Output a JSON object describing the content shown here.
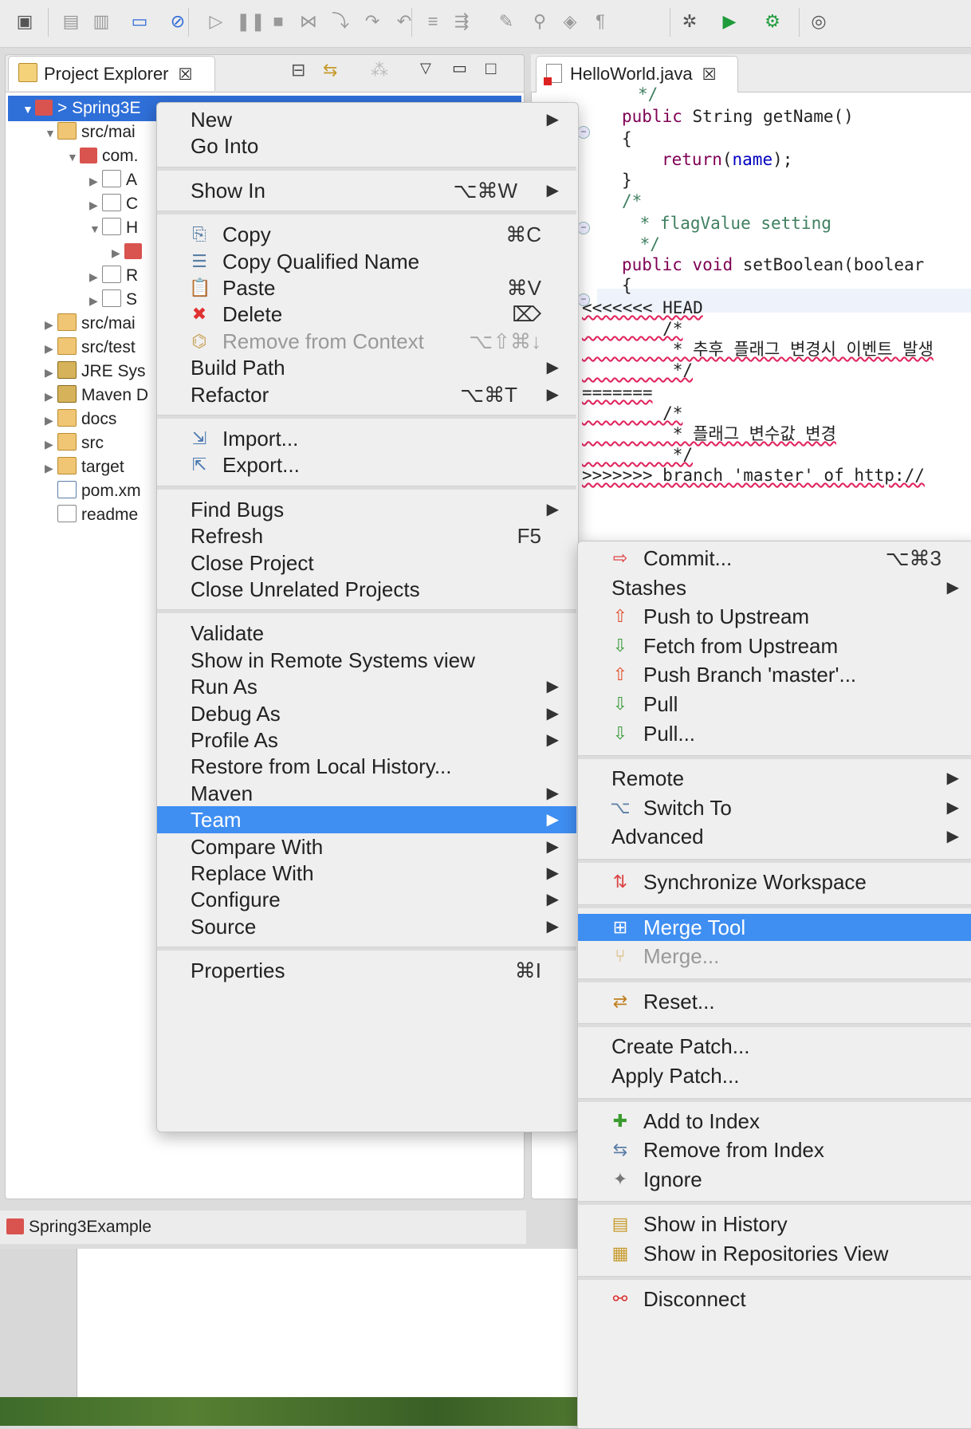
{
  "toolbar": {
    "icons": [
      "new-wizard-icon",
      "save-icon",
      "save-all-icon",
      "console-icon",
      "skip-breakpoints-icon",
      "resume-icon",
      "suspend-icon",
      "terminate-icon",
      "disconnect-icon",
      "step-into-icon",
      "step-over-icon",
      "step-return-icon",
      "toggle-mark-icon",
      "open-type-icon",
      "ant-icon",
      "search-icon",
      "build-icon",
      "format-icon",
      "bug-icon",
      "run-icon",
      "external-tools-icon",
      "web-browser-icon"
    ]
  },
  "explorer": {
    "tab_label": "Project Explorer",
    "close_glyph": "☒",
    "tree": [
      {
        "label": "> Spring3E",
        "twisty": "▼",
        "icon": "maven-project-icon",
        "selected": true
      },
      {
        "label": "src/mai",
        "twisty": "▼",
        "icon": "source-folder-icon"
      },
      {
        "label": "com.",
        "twisty": "▼",
        "icon": "package-icon"
      },
      {
        "label": "A",
        "twisty": "▶",
        "icon": "java-file-icon"
      },
      {
        "label": "C",
        "twisty": "▶",
        "icon": "java-file-icon"
      },
      {
        "label": "H",
        "twisty": "▼",
        "icon": "java-file-icon"
      },
      {
        "label": "",
        "twisty": "▶",
        "icon": "class-icon"
      },
      {
        "label": "R",
        "twisty": "▶",
        "icon": "java-file-icon"
      },
      {
        "label": "S",
        "twisty": "▶",
        "icon": "java-file-icon"
      },
      {
        "label": "src/mai",
        "twisty": "▶",
        "icon": "source-folder-icon"
      },
      {
        "label": "src/test",
        "twisty": "▶",
        "icon": "source-folder-icon"
      },
      {
        "label": "JRE Sys",
        "twisty": "▶",
        "icon": "library-icon"
      },
      {
        "label": "Maven D",
        "twisty": "▶",
        "icon": "library-icon"
      },
      {
        "label": "docs",
        "twisty": "▶",
        "icon": "folder-icon"
      },
      {
        "label": "src",
        "twisty": "▶",
        "icon": "folder-icon"
      },
      {
        "label": "target",
        "twisty": "▶",
        "icon": "folder-icon"
      },
      {
        "label": "pom.xm",
        "twisty": "",
        "icon": "xml-file-icon"
      },
      {
        "label": "readme",
        "twisty": "",
        "icon": "text-file-icon"
      }
    ],
    "status": "Spring3Example"
  },
  "editor": {
    "tab_label": "HelloWorld.java",
    "close_glyph": "☒"
  },
  "code": [
    {
      "tokens": [
        {
          "t": "*/",
          "c": "cm"
        }
      ]
    },
    {
      "tokens": [
        {
          "t": "public",
          "c": "kw"
        },
        {
          "t": " String getName()",
          "c": ""
        }
      ]
    },
    {
      "tokens": [
        {
          "t": "{",
          "c": ""
        }
      ]
    },
    {
      "tokens": [
        {
          "t": "return",
          "c": "kw"
        },
        {
          "t": "(",
          "c": ""
        },
        {
          "t": "name",
          "c": "fd"
        },
        {
          "t": ");",
          "c": ""
        }
      ]
    },
    {
      "tokens": [
        {
          "t": "}",
          "c": ""
        }
      ]
    },
    {
      "tokens": [
        {
          "t": "/*",
          "c": "cm"
        }
      ]
    },
    {
      "tokens": [
        {
          "t": " * flagValue setting",
          "c": "cm"
        }
      ]
    },
    {
      "tokens": [
        {
          "t": " */",
          "c": "cm"
        }
      ]
    },
    {
      "tokens": [
        {
          "t": "public",
          "c": "kw"
        },
        {
          "t": " ",
          "c": ""
        },
        {
          "t": "void",
          "c": "kw"
        },
        {
          "t": " setBoolean(boolear",
          "c": ""
        }
      ]
    },
    {
      "tokens": [
        {
          "t": "{",
          "c": ""
        }
      ]
    },
    {
      "tokens": [
        {
          "t": "<<<<<<< HEAD",
          "c": "conf"
        }
      ]
    },
    {
      "tokens": [
        {
          "t": "        /*",
          "c": "conf"
        }
      ]
    },
    {
      "tokens": [
        {
          "t": "         * 추후 플래그 변경시 이벤트 발생",
          "c": "conf"
        }
      ]
    },
    {
      "tokens": [
        {
          "t": "         */",
          "c": "conf"
        }
      ]
    },
    {
      "tokens": [
        {
          "t": "=======",
          "c": "conf"
        }
      ]
    },
    {
      "tokens": [
        {
          "t": "        /*",
          "c": "conf"
        }
      ]
    },
    {
      "tokens": [
        {
          "t": "         * 플래그 변수값 변경",
          "c": "conf"
        }
      ]
    },
    {
      "tokens": [
        {
          "t": "         */",
          "c": "conf"
        }
      ]
    },
    {
      "tokens": [
        {
          "t": ">>>>>>> branch 'master' of http://",
          "c": "conf"
        }
      ]
    }
  ],
  "context_menu": {
    "items": [
      {
        "label": "New",
        "submenu": true
      },
      {
        "label": "Go Into"
      },
      {
        "sep": true
      },
      {
        "label": "Show In",
        "shortcut": "⌥⌘W",
        "submenu": true
      },
      {
        "sep": true
      },
      {
        "label": "Copy",
        "shortcut": "⌘C",
        "icon": "copy-icon"
      },
      {
        "label": "Copy Qualified Name",
        "icon": "copy-qualified-name-icon"
      },
      {
        "label": "Paste",
        "shortcut": "⌘V",
        "icon": "paste-icon"
      },
      {
        "label": "Delete",
        "shortcut": "⌦",
        "icon": "delete-icon"
      },
      {
        "label": "Remove from Context",
        "shortcut": "⌥⇧⌘↓",
        "icon": "remove-context-icon",
        "disabled": true
      },
      {
        "label": "Build Path",
        "submenu": true
      },
      {
        "label": "Refactor",
        "shortcut": "⌥⌘T",
        "submenu": true
      },
      {
        "sep": true
      },
      {
        "label": "Import...",
        "icon": "import-icon"
      },
      {
        "label": "Export...",
        "icon": "export-icon"
      },
      {
        "sep": true
      },
      {
        "label": "Find Bugs",
        "submenu": true
      },
      {
        "label": "Refresh",
        "shortcut": "F5"
      },
      {
        "label": "Close Project"
      },
      {
        "label": "Close Unrelated Projects"
      },
      {
        "sep": true
      },
      {
        "label": "Validate"
      },
      {
        "label": "Show in Remote Systems view"
      },
      {
        "label": "Run As",
        "submenu": true
      },
      {
        "label": "Debug As",
        "submenu": true
      },
      {
        "label": "Profile As",
        "submenu": true
      },
      {
        "label": "Restore from Local History..."
      },
      {
        "label": "Maven",
        "submenu": true
      },
      {
        "label": "Team",
        "submenu": true,
        "highlighted": true
      },
      {
        "label": "Compare With",
        "submenu": true
      },
      {
        "label": "Replace With",
        "submenu": true
      },
      {
        "label": "Configure",
        "submenu": true
      },
      {
        "label": "Source",
        "submenu": true
      },
      {
        "sep": true
      },
      {
        "label": "Properties",
        "shortcut": "⌘I"
      }
    ]
  },
  "team_menu": {
    "items": [
      {
        "label": "Commit...",
        "shortcut": "⌥⌘3",
        "icon": "commit-icon"
      },
      {
        "label": "Stashes",
        "submenu": true
      },
      {
        "label": "Push to Upstream",
        "icon": "push-icon"
      },
      {
        "label": "Fetch from Upstream",
        "icon": "fetch-icon"
      },
      {
        "label": "Push Branch 'master'...",
        "icon": "push-branch-icon"
      },
      {
        "label": "Pull",
        "icon": "pull-icon"
      },
      {
        "label": "Pull...",
        "icon": "pull-dialog-icon"
      },
      {
        "sep": true
      },
      {
        "label": "Remote",
        "submenu": true
      },
      {
        "label": "Switch To",
        "submenu": true,
        "icon": "switch-branch-icon"
      },
      {
        "label": "Advanced",
        "submenu": true
      },
      {
        "sep": true
      },
      {
        "label": "Synchronize Workspace",
        "icon": "synchronize-icon"
      },
      {
        "sep": true
      },
      {
        "label": "Merge Tool",
        "icon": "merge-tool-icon",
        "highlighted": true
      },
      {
        "label": "Merge...",
        "icon": "merge-icon",
        "disabled": true
      },
      {
        "sep": true
      },
      {
        "label": "Reset...",
        "icon": "reset-icon"
      },
      {
        "sep": true
      },
      {
        "label": "Create Patch..."
      },
      {
        "label": "Apply Patch..."
      },
      {
        "sep": true
      },
      {
        "label": "Add to Index",
        "icon": "add-index-icon"
      },
      {
        "label": "Remove from Index",
        "icon": "remove-index-icon"
      },
      {
        "label": "Ignore",
        "icon": "ignore-icon"
      },
      {
        "sep": true
      },
      {
        "label": "Show in History",
        "icon": "history-icon"
      },
      {
        "label": "Show in Repositories View",
        "icon": "repositories-icon"
      },
      {
        "sep": true
      },
      {
        "label": "Disconnect",
        "icon": "disconnect-icon"
      }
    ]
  },
  "colors": {
    "highlight": "#3f8ef2",
    "tree_selection": "#2f6fd8",
    "keyword": "#7f0055",
    "comment": "#3f7f5f",
    "conflict_underline": "#e0245e"
  }
}
